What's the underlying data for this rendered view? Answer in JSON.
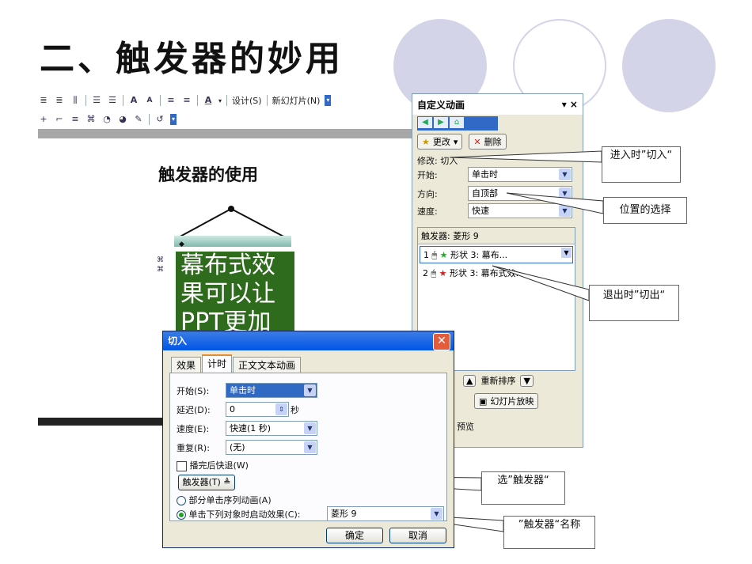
{
  "slide": {
    "title": "二、触发器的妙用",
    "inner_title": "触发器的使用",
    "banner_text": "幕布式效果可以让PPT更加"
  },
  "toolbar": {
    "row1": [
      "≣",
      "≣",
      "⫼",
      "☰",
      "☰",
      "A",
      "A",
      "≡",
      "≡",
      "A ▾",
      "设计(S)",
      "新幻灯片(N)"
    ],
    "design_label": "设计(S)",
    "new_slide_label": "新幻灯片(N)"
  },
  "pane": {
    "title": "自定义动画",
    "change_label": "更改",
    "delete_label": "删除",
    "modify_label": "修改: 切入",
    "start_label": "开始:",
    "start_value": "单击时",
    "direction_label": "方向:",
    "direction_value": "自顶部",
    "speed_label": "速度:",
    "speed_value": "快速",
    "trigger_header": "触发器: 菱形 9",
    "items": [
      {
        "num": "1",
        "label": "形状 3: 幕布..."
      },
      {
        "num": "2",
        "label": "形状 3: 幕布式效..."
      }
    ],
    "reorder_label": "重新排序",
    "slideshow_label": "幻灯片放映",
    "preview_label": "预览"
  },
  "callouts": {
    "enter": "进入时”切入“",
    "position": "位置的选择",
    "exit": "退出时”切出“",
    "select_trigger": "选”触发器“",
    "trigger_name": "”触发器“名称"
  },
  "dialog": {
    "title": "切入",
    "tabs": [
      "效果",
      "计时",
      "正文文本动画"
    ],
    "start_label": "开始(S):",
    "start_value": "单击时",
    "delay_label": "延迟(D):",
    "delay_value": "0",
    "delay_unit": "秒",
    "speed_label": "速度(E):",
    "speed_value": "快速(1 秒)",
    "repeat_label": "重复(R):",
    "repeat_value": "(无)",
    "rewind_label": "播完后快退(W)",
    "trigger_button": "触发器(T) ≜",
    "option1": "部分单击序列动画(A)",
    "option2": "单击下列对象时启动效果(C):",
    "option2_value": "菱形 9",
    "ok_label": "确定",
    "cancel_label": "取消"
  },
  "colors": {
    "banner": "#2e6b1c",
    "circles": "#d4d4e8",
    "titlebar": "#0055e5"
  }
}
